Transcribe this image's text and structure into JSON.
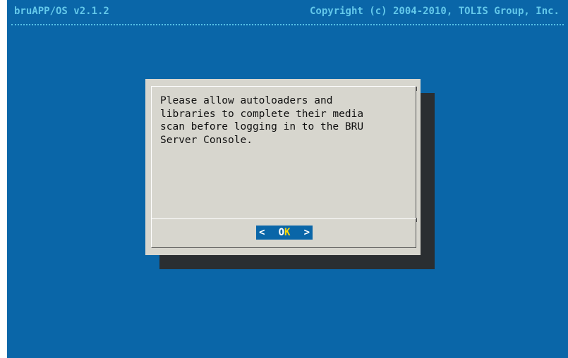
{
  "header": {
    "title": "bruAPP/OS v2.1.2",
    "copyright": "Copyright (c) 2004-2010, TOLIS Group, Inc."
  },
  "dialog": {
    "message": "Please allow autoloaders and\nlibraries to complete their media\nscan before logging in to the BRU\nServer Console.",
    "ok_button": {
      "left_bracket": "<",
      "label_prefix": "O",
      "hotkey": "K",
      "right_bracket": ">"
    }
  },
  "colors": {
    "screen_background": "#0a66a8",
    "header_text": "#63c8ea",
    "dialog_background": "#d7d6ce",
    "dialog_shadow": "#2a2e31",
    "button_background": "#0a66a8",
    "hotkey": "#ffd800"
  }
}
